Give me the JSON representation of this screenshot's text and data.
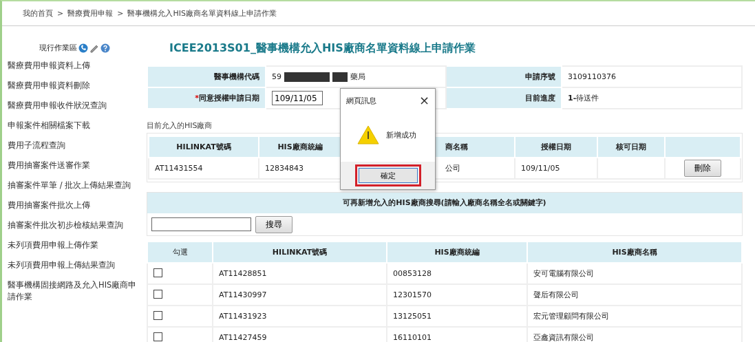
{
  "breadcrumb": {
    "separator": ">",
    "items": [
      "我的首頁",
      "醫療費用申報",
      "醫事機構允入HIS廠商名單資料線上申請作業"
    ]
  },
  "sidebar": {
    "title": "現行作業區",
    "items": [
      {
        "label": "醫療費用申報資料上傳"
      },
      {
        "label": "醫療費用申報資料刪除"
      },
      {
        "label": "醫療費用申報收件狀況查詢"
      },
      {
        "label": "申報案件相關檔案下載"
      },
      {
        "label": "費用子流程查詢"
      },
      {
        "label": "費用抽審案件送審作業"
      },
      {
        "label": "抽審案件單筆 / 批次上傳結果查詢"
      },
      {
        "label": "費用抽審案件批次上傳"
      },
      {
        "label": "抽審案件批次初步檢核結果查詢"
      },
      {
        "label": "未列項費用申報上傳作業"
      },
      {
        "label": "未列項費用申報上傳結果查詢"
      },
      {
        "label": "醫事機構固接網路及允入HIS廠商申請作業"
      }
    ]
  },
  "title": "ICEE2013S01_醫事機構允入HIS廠商名單資料線上申請作業",
  "info": {
    "code_label": "醫事機構代碼",
    "code_prefix": "59",
    "code_suffix": "藥局",
    "serial_label": "申請序號",
    "serial": "3109110376",
    "required_mark": "*",
    "date_label": "同意授權申請日期",
    "date": "109/11/05",
    "progress_label": "目前進度",
    "progress_step": "1-",
    "progress": "待送件"
  },
  "current": {
    "legend": "目前允入的HIS廠商",
    "columns": [
      "HILINKAT號碼",
      "HIS廠商統編",
      "商名稱",
      "授權日期",
      "核可日期"
    ],
    "rows": [
      {
        "cells": [
          "AT11431554",
          "12834843",
          "公司",
          "109/11/05",
          ""
        ],
        "action": "刪除"
      }
    ]
  },
  "search": {
    "heading": "可再新增允入的HIS廠商搜尋(請輸入廠商名稱全名或關鍵字)",
    "button": "搜尋"
  },
  "results": {
    "check_column": "勾選",
    "columns": [
      "HILINKAT號碼",
      "HIS廠商統編",
      "HIS廠商名稱"
    ],
    "rows": [
      {
        "checked": false,
        "cells": [
          "AT11428851",
          "00853128",
          "安可電腦有限公司"
        ]
      },
      {
        "checked": false,
        "cells": [
          "AT11430997",
          "12301570",
          "聲后有限公司"
        ]
      },
      {
        "checked": false,
        "cells": [
          "AT11431923",
          "13125051",
          "宏元管理顧問有限公司"
        ]
      },
      {
        "checked": false,
        "cells": [
          "AT11427459",
          "16110101",
          "亞鑫資訊有限公司"
        ]
      }
    ]
  },
  "dialog": {
    "title": "網頁訊息",
    "close": "×",
    "message": "新增成功",
    "button": "確定"
  }
}
